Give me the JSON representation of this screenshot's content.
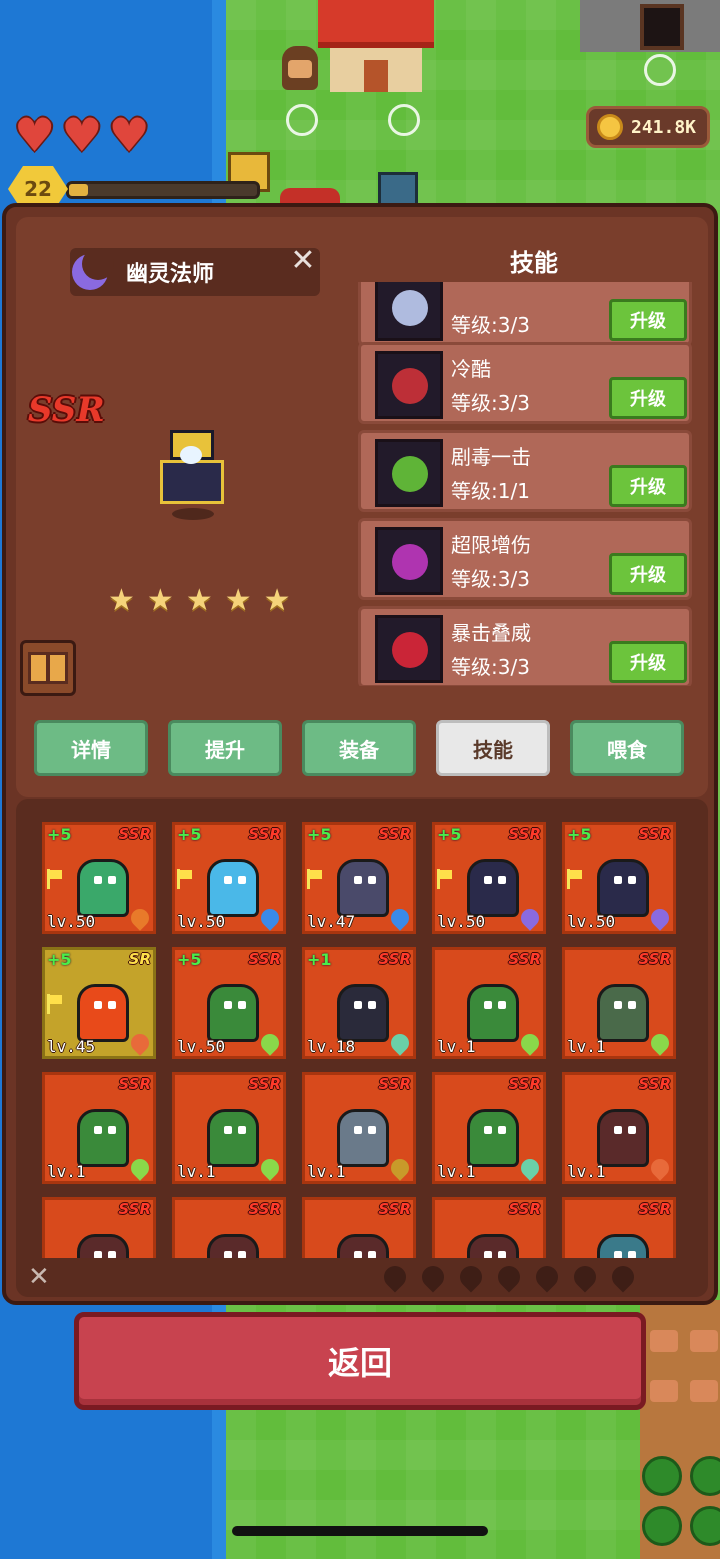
{
  "hud": {
    "hearts": 3,
    "level": "22",
    "xp_progress": 0.1,
    "coins": "241.8K"
  },
  "hero": {
    "name": "幽灵法师",
    "rarity": "SSR",
    "stars": 5
  },
  "skills": {
    "title": "技能",
    "upgrade_label": "升级",
    "items": [
      {
        "name": "",
        "level": "等级:3/3",
        "icon": "sword-slash-icon",
        "color": "#c8d8ff"
      },
      {
        "name": "冷酷",
        "level": "等级:3/3",
        "icon": "blood-drop-icon",
        "color": "#d8343a"
      },
      {
        "name": "剧毒一击",
        "level": "等级:1/1",
        "icon": "poison-skull-icon",
        "color": "#6ad03a"
      },
      {
        "name": "超限增伤",
        "level": "等级:3/3",
        "icon": "dark-aura-icon",
        "color": "#c83ac8"
      },
      {
        "name": "暴击叠威",
        "level": "等级:3/3",
        "icon": "crit-ring-icon",
        "color": "#e8283a"
      }
    ]
  },
  "tabs": [
    {
      "label": "详情",
      "active": false
    },
    {
      "label": "提升",
      "active": false
    },
    {
      "label": "装备",
      "active": false
    },
    {
      "label": "技能",
      "active": true
    },
    {
      "label": "喂食",
      "active": false
    }
  ],
  "roster": [
    {
      "plus": "+5",
      "rank": "SSR",
      "lv": "lv.50",
      "flag": true,
      "color": "#3aa86a",
      "elem": "#e87a2a"
    },
    {
      "plus": "+5",
      "rank": "SSR",
      "lv": "lv.50",
      "flag": true,
      "color": "#4ab8e8",
      "elem": "#3a8ae8"
    },
    {
      "plus": "+5",
      "rank": "SSR",
      "lv": "lv.47",
      "flag": true,
      "color": "#4a4a6a",
      "elem": "#3a8ae8"
    },
    {
      "plus": "+5",
      "rank": "SSR",
      "lv": "lv.50",
      "flag": true,
      "color": "#2a2a4a",
      "elem": "#8a6ae0"
    },
    {
      "plus": "+5",
      "rank": "SSR",
      "lv": "lv.50",
      "flag": true,
      "color": "#2a2a4a",
      "elem": "#8a6ae0"
    },
    {
      "plus": "+5",
      "rank": "SR",
      "lv": "lv.45",
      "flag": true,
      "color": "#e84a1a",
      "elem": "#e86a3a",
      "sr": true
    },
    {
      "plus": "+5",
      "rank": "SSR",
      "lv": "lv.50",
      "flag": false,
      "color": "#3a8a3a",
      "elem": "#8ad84a"
    },
    {
      "plus": "+1",
      "rank": "SSR",
      "lv": "lv.18",
      "flag": false,
      "color": "#2a2a3a",
      "elem": "#6ad0a8"
    },
    {
      "plus": "",
      "rank": "SSR",
      "lv": "lv.1",
      "flag": false,
      "color": "#3a8a3a",
      "elem": "#8ad84a"
    },
    {
      "plus": "",
      "rank": "SSR",
      "lv": "lv.1",
      "flag": false,
      "color": "#4a6a4a",
      "elem": "#8ad84a"
    },
    {
      "plus": "",
      "rank": "SSR",
      "lv": "lv.1",
      "flag": false,
      "color": "#3a8a3a",
      "elem": "#8ad84a"
    },
    {
      "plus": "",
      "rank": "SSR",
      "lv": "lv.1",
      "flag": false,
      "color": "#3a8a3a",
      "elem": "#8ad84a"
    },
    {
      "plus": "",
      "rank": "SSR",
      "lv": "lv.1",
      "flag": false,
      "color": "#6a7a8a",
      "elem": "#c89a2a"
    },
    {
      "plus": "",
      "rank": "SSR",
      "lv": "lv.1",
      "flag": false,
      "color": "#3a8a3a",
      "elem": "#6ad0a8"
    },
    {
      "plus": "",
      "rank": "SSR",
      "lv": "lv.1",
      "flag": false,
      "color": "#5a2a2a",
      "elem": "#e86a3a"
    },
    {
      "plus": "",
      "rank": "SSR",
      "lv": "",
      "flag": false,
      "color": "#5a2a2a",
      "elem": ""
    },
    {
      "plus": "",
      "rank": "SSR",
      "lv": "",
      "flag": false,
      "color": "#5a2a2a",
      "elem": ""
    },
    {
      "plus": "",
      "rank": "SSR",
      "lv": "",
      "flag": false,
      "color": "#5a2a2a",
      "elem": ""
    },
    {
      "plus": "",
      "rank": "SSR",
      "lv": "",
      "flag": false,
      "color": "#5a2a2a",
      "elem": ""
    },
    {
      "plus": "",
      "rank": "SSR",
      "lv": "",
      "flag": false,
      "color": "#3a7a8a",
      "elem": ""
    }
  ],
  "back_button": "返回"
}
